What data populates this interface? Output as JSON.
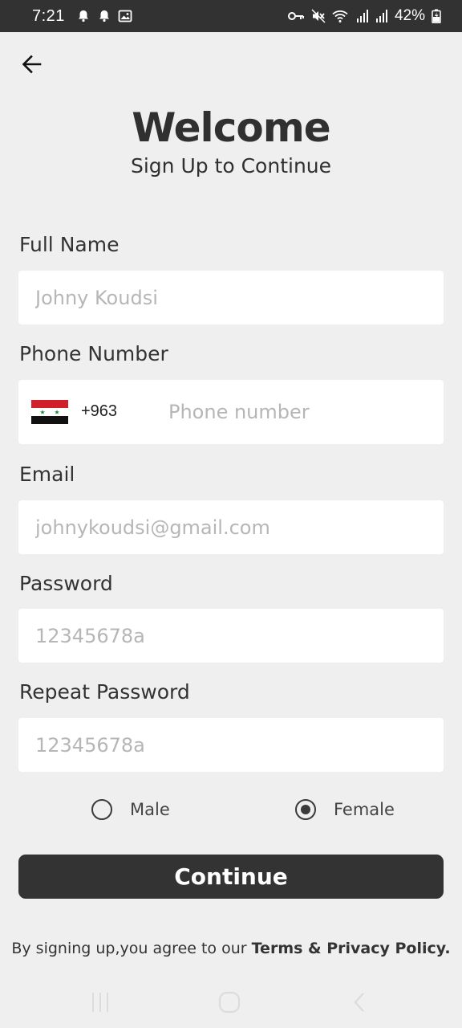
{
  "status_bar": {
    "time": "7:21",
    "battery": "42%",
    "left_icons": [
      "notification-bell-icon",
      "notification-bell-icon",
      "image-icon"
    ],
    "right_icons": [
      "vpn-key-icon",
      "mute-icon",
      "wifi-icon",
      "signal-icon",
      "signal-icon",
      "battery-charging-icon"
    ]
  },
  "header": {
    "title": "Welcome",
    "subtitle": "Sign Up to Continue"
  },
  "form": {
    "full_name": {
      "label": "Full Name",
      "placeholder": "Johny Koudsi",
      "value": ""
    },
    "phone": {
      "label": "Phone Number",
      "country_code": "+963",
      "placeholder": "Phone number",
      "value": "",
      "flag": "syria-flag"
    },
    "email": {
      "label": "Email",
      "placeholder": "johnykoudsi@gmail.com",
      "value": ""
    },
    "password": {
      "label": "Password",
      "placeholder": "12345678a",
      "value": ""
    },
    "repeat_password": {
      "label": "Repeat Password",
      "placeholder": "12345678a",
      "value": ""
    },
    "gender": {
      "options": [
        "Male",
        "Female"
      ],
      "selected": "Female"
    }
  },
  "continue_label": "Continue",
  "terms": {
    "prefix": "By signing up,you agree to our ",
    "link": "Terms & Privacy Policy."
  },
  "colors": {
    "background": "#efefef",
    "primary_button": "#333333",
    "status_bar": "#323232",
    "placeholder": "#b6b6b6"
  },
  "nav_bar": [
    "recents-icon",
    "home-icon",
    "back-icon"
  ]
}
